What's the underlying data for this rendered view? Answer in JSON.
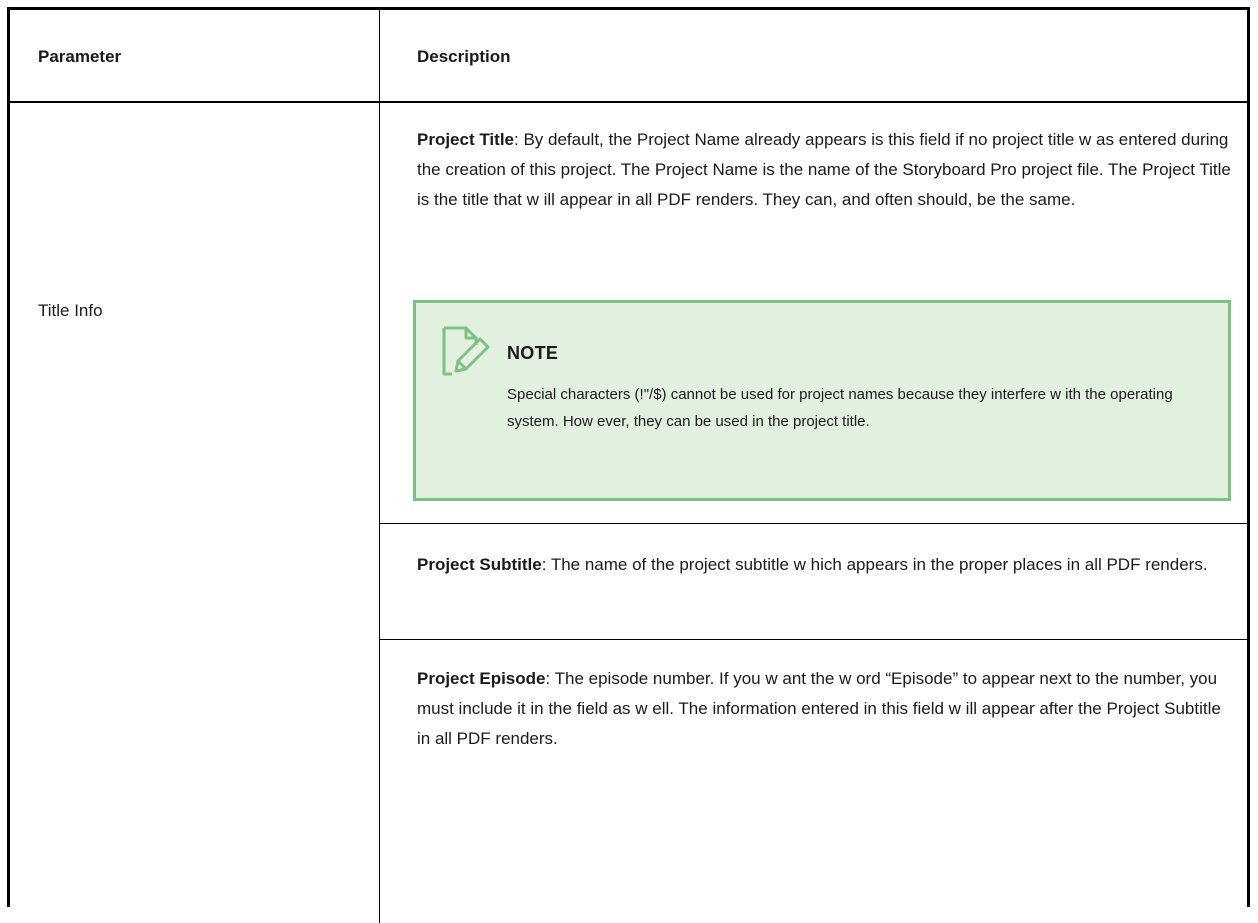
{
  "table": {
    "headers": {
      "parameter": "Parameter",
      "description": "Description"
    },
    "rows": [
      {
        "parameter": "Title Info",
        "descriptions": [
          {
            "term": "Project Title",
            "text": ": By default, the Project Name already appears is this field if no project title w as entered during the creation of this project. The Project Name is the name of the Storyboard Pro project file. The Project Title is the title that w ill appear in all PDF renders. They can, and often should, be the same."
          },
          {
            "term": "Project Subtitle",
            "text": ": The name of the project subtitle w hich appears in the proper places in all PDF renders."
          },
          {
            "term": "Project Episode",
            "text": ": The episode number. If you w ant the w ord “Episode” to appear next to the number, you must include it in the field as w ell. The information entered in this field w ill appear after the Project Subtitle in all PDF renders."
          }
        ],
        "note": {
          "icon": "note-pencil-icon",
          "title": "NOTE",
          "text": "Special characters (!\"/$) cannot be used for project names because they interfere w ith the operating system. How ever, they can be used in the project title."
        }
      }
    ]
  },
  "colors": {
    "note_background": "#e2f0e0",
    "note_border": "#7fc083",
    "table_border": "#000000"
  }
}
